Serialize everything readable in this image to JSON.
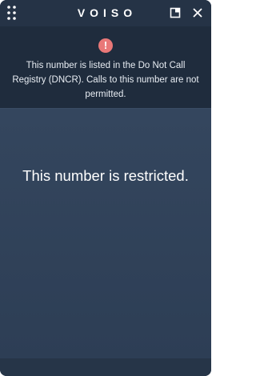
{
  "window": {
    "brand": "VOISO"
  },
  "alert": {
    "icon": "exclamation-icon",
    "icon_glyph": "!",
    "message": "This number is listed in the Do Not Call Registry (DNCR). Calls to this number are not permitted."
  },
  "main": {
    "status_text": "This number is restricted."
  },
  "colors": {
    "header_bg": "#253346",
    "alert_bg": "#1f2c3d",
    "body_bg": "#2f4159",
    "alert_icon": "#e97878"
  },
  "icons": {
    "drag": "drag-handle-icon",
    "maximize": "maximize-icon",
    "close": "close-icon"
  }
}
